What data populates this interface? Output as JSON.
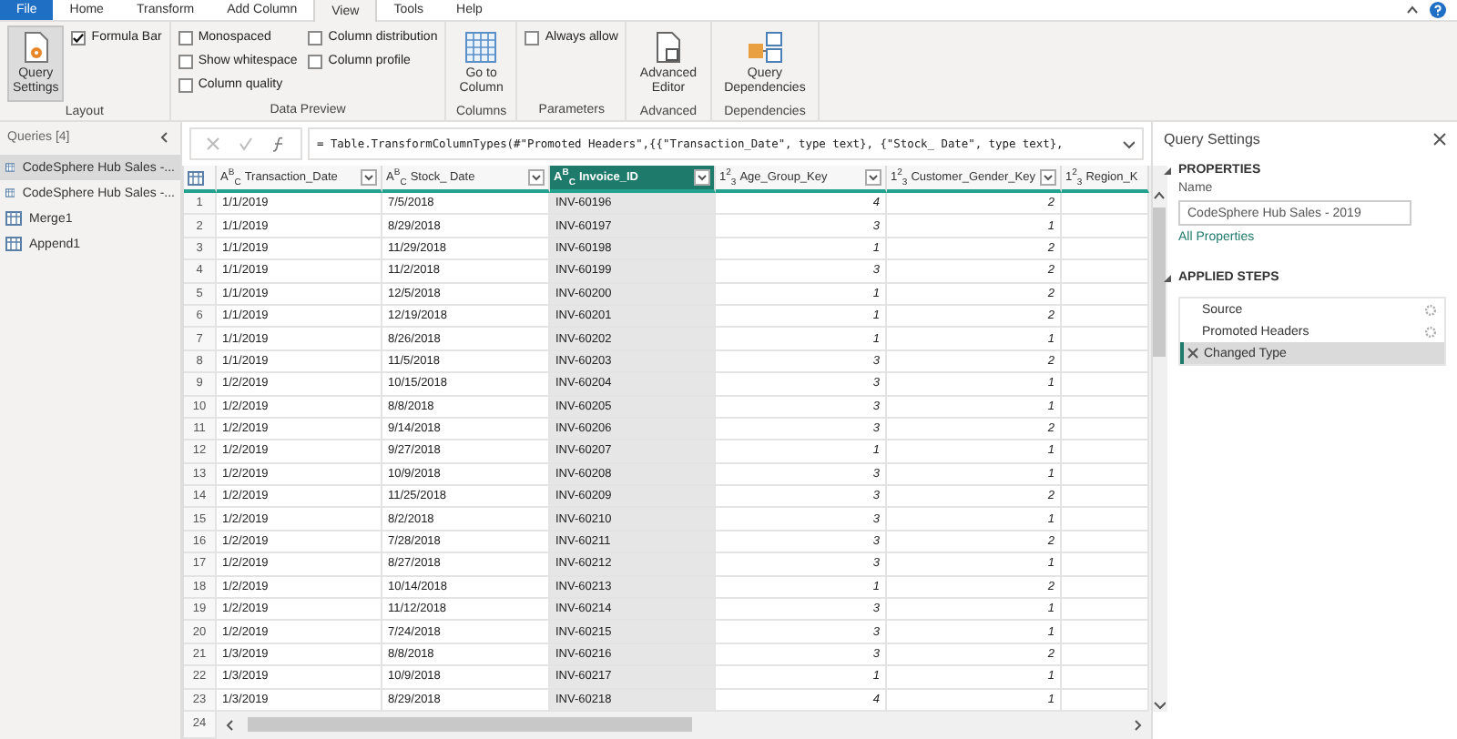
{
  "ribbon": {
    "tabs": [
      {
        "label": "File",
        "kind": "file",
        "selected": false
      },
      {
        "label": "Home",
        "kind": "tab",
        "selected": false
      },
      {
        "label": "Transform",
        "kind": "tab",
        "selected": false
      },
      {
        "label": "Add Column",
        "kind": "tab",
        "selected": false
      },
      {
        "label": "View",
        "kind": "tab",
        "selected": true
      },
      {
        "label": "Tools",
        "kind": "tab",
        "selected": false
      },
      {
        "label": "Help",
        "kind": "tab",
        "selected": false
      }
    ],
    "groups": [
      {
        "label": "Layout",
        "items": [
          {
            "kind": "big",
            "label": "Query\nSettings",
            "selected": true
          },
          {
            "kind": "check",
            "label": "Formula Bar",
            "checked": true
          }
        ]
      },
      {
        "label": "Data Preview",
        "items": [
          {
            "kind": "check",
            "label": "Monospaced",
            "checked": false
          },
          {
            "kind": "check",
            "label": "Show whitespace",
            "checked": false
          },
          {
            "kind": "check",
            "label": "Column quality",
            "checked": false
          },
          {
            "kind": "check",
            "label": "Column distribution",
            "checked": false
          },
          {
            "kind": "check",
            "label": "Column profile",
            "checked": false
          }
        ]
      },
      {
        "label": "Columns",
        "items": [
          {
            "kind": "big",
            "label": "Go to\nColumn",
            "selected": false
          }
        ]
      },
      {
        "label": "Parameters",
        "items": [
          {
            "kind": "check",
            "label": "Always allow",
            "checked": false
          }
        ]
      },
      {
        "label": "Advanced",
        "items": [
          {
            "kind": "big",
            "label": "Advanced\nEditor",
            "selected": false
          }
        ]
      },
      {
        "label": "Dependencies",
        "items": [
          {
            "kind": "big",
            "label": "Query\nDependencies",
            "selected": false
          }
        ]
      }
    ]
  },
  "queries": {
    "title": "Queries [4]",
    "items": [
      {
        "label": "CodeSphere Hub Sales -...",
        "selected": true
      },
      {
        "label": "CodeSphere Hub Sales -...",
        "selected": false
      },
      {
        "label": "Merge1",
        "selected": false
      },
      {
        "label": "Append1",
        "selected": false
      }
    ]
  },
  "formula": "= Table.TransformColumnTypes(#\"Promoted Headers\",{{\"Transaction_Date\", type text}, {\"Stock_ Date\", type text},",
  "table": {
    "columns": [
      {
        "type": "A$^{B}$$_{C}$",
        "name": "Transaction_Date",
        "kind": "text",
        "selected": false,
        "filter": true
      },
      {
        "type": "A$^{B}$$_{C}$",
        "name": "Stock_ Date",
        "kind": "text",
        "selected": false,
        "filter": true
      },
      {
        "type": "A$^{B}$$_{C}$",
        "name": "Invoice_ID",
        "kind": "text",
        "selected": true,
        "filter": true
      },
      {
        "type": "1$^{2}$$_{3}$",
        "name": "Age_Group_Key",
        "kind": "number",
        "selected": false,
        "filter": true
      },
      {
        "type": "1$^{2}$$_{3}$",
        "name": "Customer_Gender_Key",
        "kind": "number",
        "selected": false,
        "filter": true
      },
      {
        "type": "1$^{2}$$_{3}$",
        "name": "Region_K",
        "kind": "number",
        "selected": false,
        "filter": false
      }
    ],
    "rows": [
      {
        "n": "1",
        "cells": [
          "1/1/2019",
          "7/5/2018",
          "INV-60196",
          "4",
          "2"
        ]
      },
      {
        "n": "2",
        "cells": [
          "1/1/2019",
          "8/29/2018",
          "INV-60197",
          "3",
          "1"
        ]
      },
      {
        "n": "3",
        "cells": [
          "1/1/2019",
          "11/29/2018",
          "INV-60198",
          "1",
          "2"
        ]
      },
      {
        "n": "4",
        "cells": [
          "1/1/2019",
          "11/2/2018",
          "INV-60199",
          "3",
          "2"
        ]
      },
      {
        "n": "5",
        "cells": [
          "1/1/2019",
          "12/5/2018",
          "INV-60200",
          "1",
          "2"
        ]
      },
      {
        "n": "6",
        "cells": [
          "1/1/2019",
          "12/19/2018",
          "INV-60201",
          "1",
          "2"
        ]
      },
      {
        "n": "7",
        "cells": [
          "1/1/2019",
          "8/26/2018",
          "INV-60202",
          "1",
          "1"
        ]
      },
      {
        "n": "8",
        "cells": [
          "1/1/2019",
          "11/5/2018",
          "INV-60203",
          "3",
          "2"
        ]
      },
      {
        "n": "9",
        "cells": [
          "1/2/2019",
          "10/15/2018",
          "INV-60204",
          "3",
          "1"
        ]
      },
      {
        "n": "10",
        "cells": [
          "1/2/2019",
          "8/8/2018",
          "INV-60205",
          "3",
          "1"
        ]
      },
      {
        "n": "11",
        "cells": [
          "1/2/2019",
          "9/14/2018",
          "INV-60206",
          "3",
          "2"
        ]
      },
      {
        "n": "12",
        "cells": [
          "1/2/2019",
          "9/27/2018",
          "INV-60207",
          "1",
          "1"
        ]
      },
      {
        "n": "13",
        "cells": [
          "1/2/2019",
          "10/9/2018",
          "INV-60208",
          "3",
          "1"
        ]
      },
      {
        "n": "14",
        "cells": [
          "1/2/2019",
          "11/25/2018",
          "INV-60209",
          "3",
          "2"
        ]
      },
      {
        "n": "15",
        "cells": [
          "1/2/2019",
          "8/2/2018",
          "INV-60210",
          "3",
          "1"
        ]
      },
      {
        "n": "16",
        "cells": [
          "1/2/2019",
          "7/28/2018",
          "INV-60211",
          "3",
          "2"
        ]
      },
      {
        "n": "17",
        "cells": [
          "1/2/2019",
          "8/27/2018",
          "INV-60212",
          "3",
          "1"
        ]
      },
      {
        "n": "18",
        "cells": [
          "1/2/2019",
          "10/14/2018",
          "INV-60213",
          "1",
          "2"
        ]
      },
      {
        "n": "19",
        "cells": [
          "1/2/2019",
          "11/12/2018",
          "INV-60214",
          "3",
          "1"
        ]
      },
      {
        "n": "20",
        "cells": [
          "1/2/2019",
          "7/24/2018",
          "INV-60215",
          "3",
          "1"
        ]
      },
      {
        "n": "21",
        "cells": [
          "1/3/2019",
          "8/8/2018",
          "INV-60216",
          "3",
          "2"
        ]
      },
      {
        "n": "22",
        "cells": [
          "1/3/2019",
          "10/9/2018",
          "INV-60217",
          "1",
          "1"
        ]
      },
      {
        "n": "23",
        "cells": [
          "1/3/2019",
          "8/29/2018",
          "INV-60218",
          "4",
          "1"
        ]
      }
    ],
    "last_row_number": "24"
  },
  "settings": {
    "title": "Query Settings",
    "properties_heading": "PROPERTIES",
    "name_label": "Name",
    "name_value": "CodeSphere Hub Sales - 2019",
    "all_properties": "All Properties",
    "steps_heading": "APPLIED STEPS",
    "steps": [
      {
        "label": "Source",
        "selected": false,
        "settings": true
      },
      {
        "label": "Promoted Headers",
        "selected": false,
        "settings": true
      },
      {
        "label": "Changed Type",
        "selected": true,
        "settings": false
      }
    ]
  }
}
